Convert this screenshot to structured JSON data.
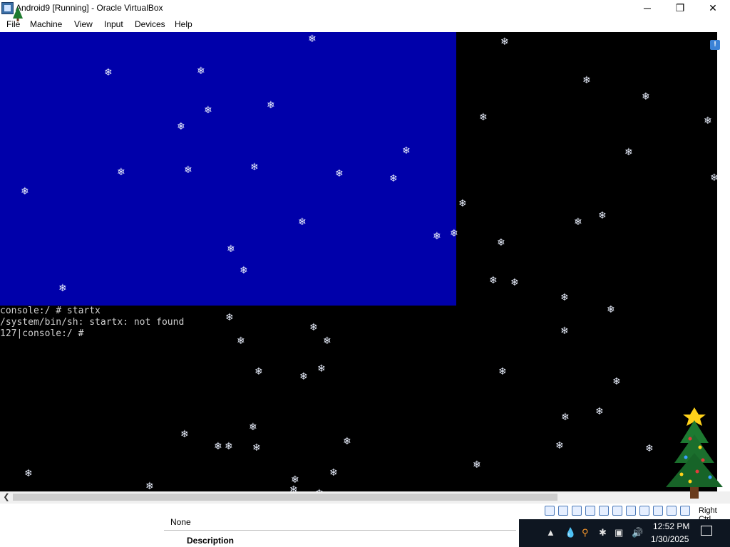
{
  "window": {
    "title": "Android9 [Running] - Oracle VirtualBox",
    "controls": {
      "minimize": "─",
      "restore": "❐",
      "close": "✕"
    }
  },
  "menubar": {
    "items": [
      "File",
      "Machine",
      "View",
      "Input",
      "Devices",
      "Help"
    ]
  },
  "console": {
    "lines": [
      "console:/ # startx",
      "/system/bin/sh: startx: not found",
      "127|console:/ #"
    ]
  },
  "status": {
    "host_key": "Right Ctrl",
    "info_badge": "!"
  },
  "host_panel": {
    "value": "None",
    "desc": "Description"
  },
  "taskbar": {
    "time": "12:52 PM",
    "date": "1/30/2025"
  },
  "colors": {
    "vm_blue": "#0000aa",
    "console_text": "#cfcfcf",
    "taskbar_bg": "#0e1621"
  },
  "icons": [
    "virtualbox-icon",
    "minimize-icon",
    "restore-icon",
    "close-icon",
    "info-icon",
    "snowflake-icon",
    "christmas-tree-icon",
    "volume-icon",
    "network-icon",
    "notification-icon"
  ]
}
